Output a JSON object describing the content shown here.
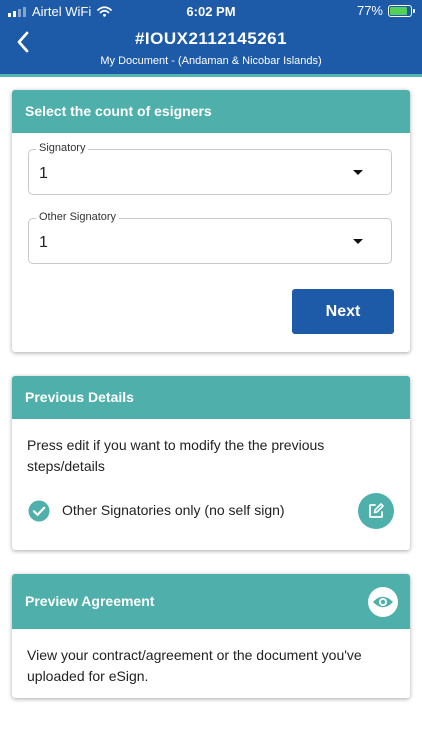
{
  "status_bar": {
    "carrier": "Airtel WiFi",
    "time": "6:02 PM",
    "battery_percent": "77%",
    "battery_level": 0.77
  },
  "header": {
    "title": "#IOUX2112145261",
    "subtitle": "My Document - (Andaman & Nicobar Islands)"
  },
  "esigners_card": {
    "title": "Select the count of esigners",
    "signatory_label": "Signatory",
    "signatory_value": "1",
    "other_signatory_label": "Other Signatory",
    "other_signatory_value": "1",
    "next_label": "Next"
  },
  "previous_card": {
    "title": "Previous Details",
    "description": "Press edit if you want to modify the the previous steps/details",
    "option_label": "Other Signatories only (no self sign)"
  },
  "preview_card": {
    "title": "Preview Agreement",
    "description": "View your contract/agreement or the document you've uploaded for eSign."
  },
  "colors": {
    "header_blue": "#1d5aa8",
    "teal": "#4fb0ab",
    "battery_green": "#54d15a"
  }
}
